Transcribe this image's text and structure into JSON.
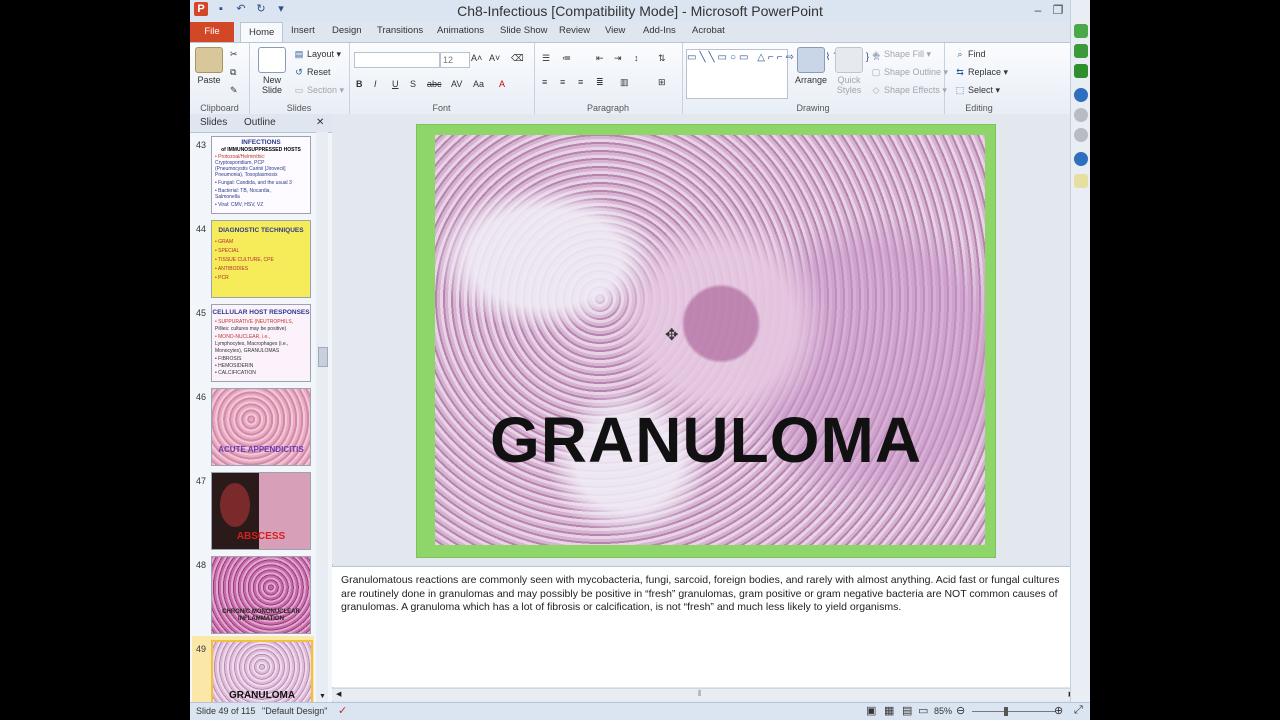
{
  "window": {
    "title": "Ch8-Infectious [Compatibility Mode]  -  Microsoft PowerPoint",
    "qat_icons": [
      "powerpoint-logo",
      "save-icon",
      "undo-icon",
      "redo-icon"
    ],
    "controls": [
      "minimize",
      "restore",
      "close"
    ]
  },
  "tabs": [
    "File",
    "Home",
    "Insert",
    "Design",
    "Transitions",
    "Animations",
    "Slide Show",
    "Review",
    "View",
    "Add-Ins",
    "Acrobat"
  ],
  "ribbon": {
    "clipboard": {
      "label": "Clipboard",
      "paste": "Paste"
    },
    "slides": {
      "label": "Slides",
      "new_slide": "New Slide",
      "layout": "Layout",
      "reset": "Reset",
      "section": "Section"
    },
    "font": {
      "label": "Font",
      "font_name": "",
      "font_size": "12",
      "buttons": [
        "B",
        "I",
        "U",
        "S",
        "abc",
        "AV",
        "Aa",
        "A"
      ]
    },
    "paragraph": {
      "label": "Paragraph"
    },
    "drawing": {
      "label": "Drawing",
      "arrange": "Arrange",
      "quick_styles": "Quick Styles",
      "shape_fill": "Shape Fill",
      "shape_outline": "Shape Outline",
      "shape_effects": "Shape Effects"
    },
    "editing": {
      "label": "Editing",
      "find": "Find",
      "replace": "Replace",
      "select": "Select"
    }
  },
  "slides_pane": {
    "tabs": [
      "Slides",
      "Outline"
    ],
    "thumbs": [
      {
        "num": "43",
        "title": "INFECTIONS",
        "subtitle": "of IMMUNOSUPPRESSED HOSTS",
        "lines": [
          "• Protozoal/Helminthic:",
          "Cryptosporidium, PCP",
          "(Pneumocystis Carinii [Jirovecii]",
          "Pneumonia), Toxoplasmosis",
          "• Fungal: Candida, and the usual 3",
          "• Bacterial: TB, Nocardia,",
          "Salmonella",
          "• Viral: CMV, HSV, VZ"
        ]
      },
      {
        "num": "44",
        "title": "DIAGNOSTIC TECHNIQUES",
        "lines": [
          "• GRAM",
          "• SPECIAL",
          "• TISSUE CULTURE, CPE",
          "• ANTIBODIES",
          "• PCR"
        ]
      },
      {
        "num": "45",
        "title": "CELLULAR HOST RESPONSES",
        "lines": [
          "• SUPPURATIVE (NEUTROPHILS,",
          "Pillies: cultures may be positive)",
          "• MONO-NUCLEAR, i.e.,",
          "Lymphocytes, Macrophages (i.e.,",
          "Monocytes), GRANULOMAS",
          "• FIBROSIS",
          "• HEMOSIDERIN",
          "• CALCIFICATION"
        ]
      },
      {
        "num": "46",
        "caption": "ACUTE APPENDICITIS"
      },
      {
        "num": "47",
        "caption": "ABSCESS"
      },
      {
        "num": "48",
        "caption": "CHRONIC MONONUCLEAR INFLAMMATION"
      },
      {
        "num": "49",
        "caption": "GRANULOMA"
      }
    ]
  },
  "slide": {
    "title": "GRANULOMA"
  },
  "notes": "Granulomatous reactions are commonly seen with mycobacteria, fungi, sarcoid, foreign bodies, and rarely with almost anything. Acid fast or fungal cultures are routinely done in granulomas and may possibly be positive in “fresh” granulomas, gram positive or gram negative bacteria are NOT common causes of granulomas. A granuloma which has a lot of fibrosis or calcification, is not “fresh” and much less likely to yield organisms.",
  "status": {
    "slide": "Slide 49 of 115",
    "theme": "\"Default Design\"",
    "zoom": "85%"
  },
  "colors": {
    "file_tab": "#d24726",
    "slide_border": "#8fd66a",
    "selected_thumb": "#f0c040"
  }
}
